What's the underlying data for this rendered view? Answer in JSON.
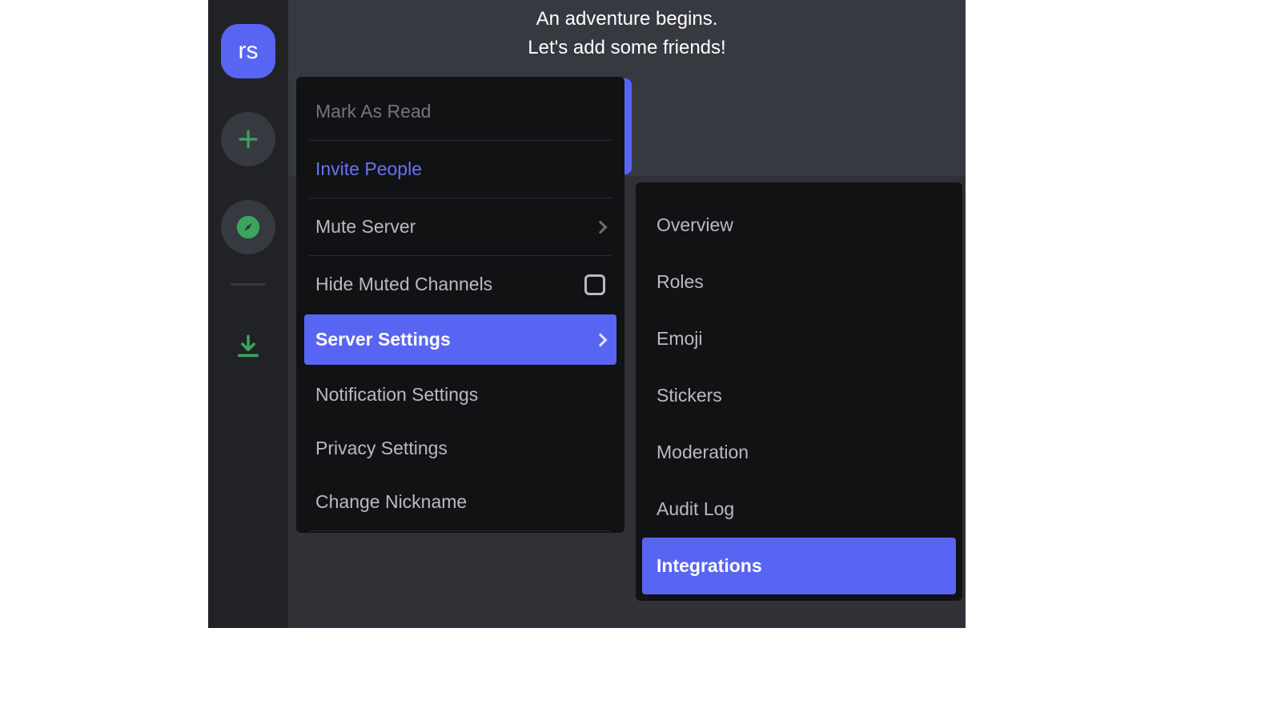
{
  "welcome": {
    "line1": "An adventure begins.",
    "line2": "Let's add some friends!"
  },
  "rail": {
    "server_initials": "rs"
  },
  "context_menu": {
    "mark_as_read": "Mark As Read",
    "invite_people": "Invite People",
    "mute_server": "Mute Server",
    "hide_muted_channels": "Hide Muted Channels",
    "server_settings": "Server Settings",
    "notification_settings": "Notification Settings",
    "privacy_settings": "Privacy Settings",
    "change_nickname": "Change Nickname"
  },
  "server_settings_submenu": {
    "overview": "Overview",
    "roles": "Roles",
    "emoji": "Emoji",
    "stickers": "Stickers",
    "moderation": "Moderation",
    "audit_log": "Audit Log",
    "integrations": "Integrations"
  }
}
